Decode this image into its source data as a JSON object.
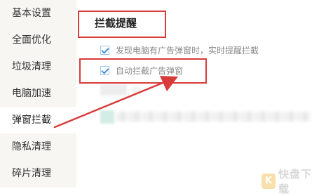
{
  "sidebar": {
    "items": [
      {
        "label": "基本设置",
        "active": false
      },
      {
        "label": "全面优化",
        "active": false
      },
      {
        "label": "垃圾清理",
        "active": false
      },
      {
        "label": "电脑加速",
        "active": false
      },
      {
        "label": "弹窗拦截",
        "active": true
      },
      {
        "label": "隐私清理",
        "active": false
      },
      {
        "label": "碎片清理",
        "active": false
      }
    ]
  },
  "section": {
    "title": "拦截提醒",
    "options": [
      {
        "label": "发现电脑有广告弹窗时，实时提醒拦截",
        "checked": true
      },
      {
        "label": "自动拦截广告弹窗",
        "checked": true
      }
    ]
  },
  "annotation": {
    "color": "#d83b3b"
  },
  "watermark": {
    "text": "快盘下载"
  }
}
